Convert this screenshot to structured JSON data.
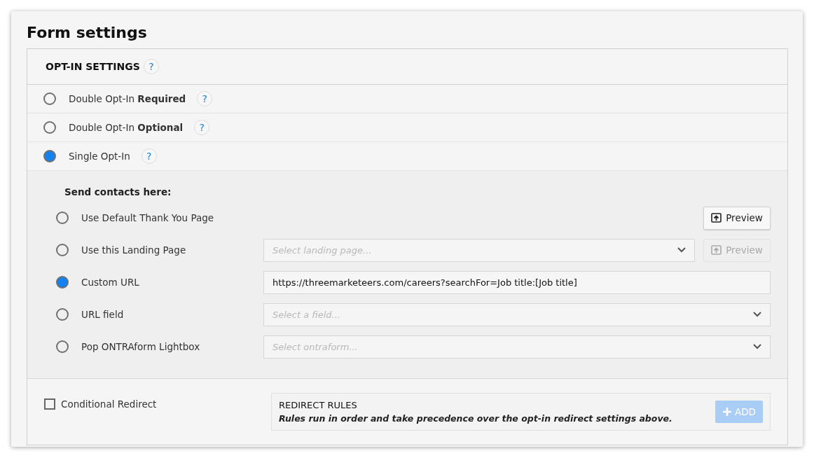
{
  "title": "Form settings",
  "opt_in": {
    "heading": "OPT-IN SETTINGS",
    "help": "?",
    "options": [
      {
        "label": "Double Opt-In **Required**",
        "help": "?",
        "selected": false
      },
      {
        "label": "Double Opt-In **Optional**",
        "help": "?",
        "selected": false
      },
      {
        "label": "Single Opt-In",
        "help": "?",
        "selected": true
      }
    ]
  },
  "destinations": {
    "heading": "Send contacts here:",
    "options": [
      {
        "kind": "plain",
        "label": "Use Default Thank You Page",
        "selected": false,
        "preview": {
          "label": "Preview",
          "disabled": false
        }
      },
      {
        "kind": "select",
        "label": "Use this Landing Page",
        "selected": false,
        "placeholder": "Select landing page...",
        "preview": {
          "label": "Preview",
          "disabled": true
        }
      },
      {
        "kind": "text",
        "label": "Custom URL",
        "selected": true,
        "value": "https://threemarketeers.com/careers?searchFor=Job title:[Job title]"
      },
      {
        "kind": "select",
        "label": "URL field",
        "selected": false,
        "placeholder": "Select a field..."
      },
      {
        "kind": "select",
        "label": "Pop ONTRAform Lightbox",
        "selected": false,
        "placeholder": "Select ontraform..."
      }
    ]
  },
  "redirect": {
    "label": "Conditional Redirect",
    "checked": false,
    "rules_title": "REDIRECT RULES",
    "rules_note": "Rules run in order and take precedence over the opt-in redirect settings above.",
    "add_button": {
      "label": "ADD",
      "disabled": true
    }
  }
}
